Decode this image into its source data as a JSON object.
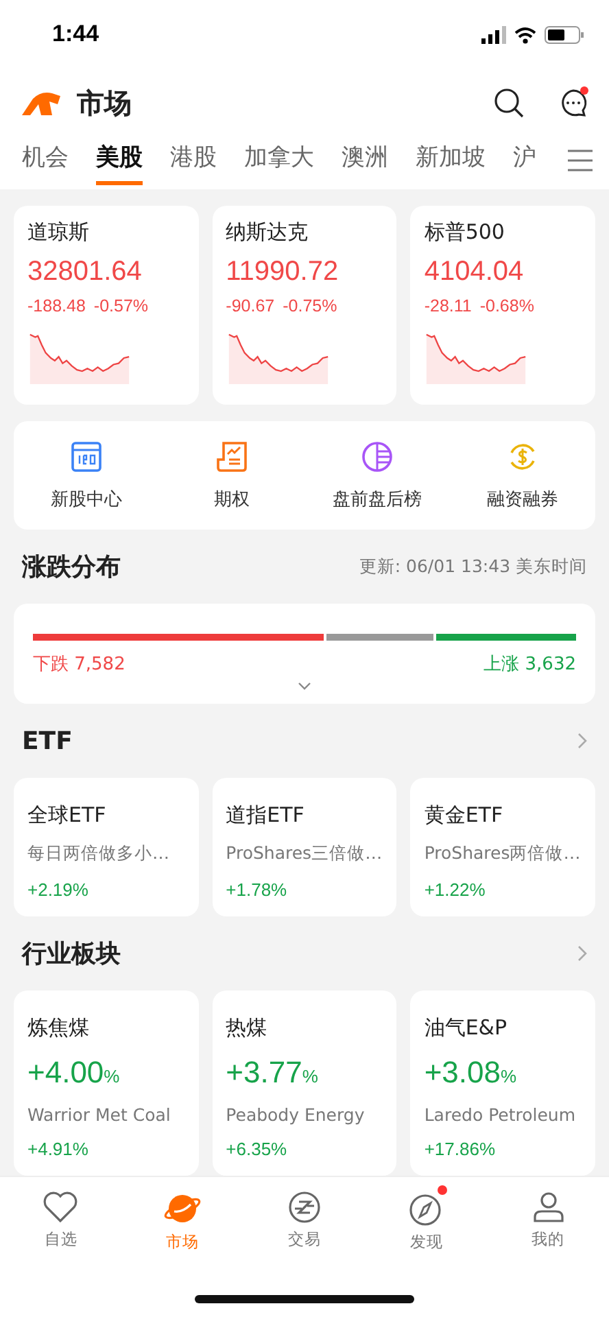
{
  "status_bar": {
    "time": "1:44"
  },
  "header": {
    "title": "市场",
    "message_badge": true
  },
  "tabs": [
    {
      "label": "机会",
      "selected": false
    },
    {
      "label": "美股",
      "selected": true
    },
    {
      "label": "港股",
      "selected": false
    },
    {
      "label": "加拿大",
      "selected": false
    },
    {
      "label": "澳洲",
      "selected": false
    },
    {
      "label": "新加坡",
      "selected": false
    },
    {
      "label": "沪",
      "selected": false
    }
  ],
  "indices": [
    {
      "name": "道琼斯",
      "price": "32801.64",
      "change": "-188.48",
      "percent": "-0.57%"
    },
    {
      "name": "纳斯达克",
      "price": "11990.72",
      "change": "-90.67",
      "percent": "-0.75%"
    },
    {
      "name": "标普500",
      "price": "4104.04",
      "change": "-28.11",
      "percent": "-0.68%"
    }
  ],
  "shortcuts": [
    {
      "kind": "ipo",
      "label": "新股中心"
    },
    {
      "kind": "options",
      "label": "期权"
    },
    {
      "kind": "prepost",
      "label": "盘前盘后榜"
    },
    {
      "kind": "margin",
      "label": "融资融券"
    }
  ],
  "breadth": {
    "title": "涨跌分布",
    "updated": "更新: 06/01 13:43 美东时间",
    "down_label": "下跌 7,582",
    "up_label": "上涨 3,632"
  },
  "etf": {
    "title": "ETF",
    "cards": [
      {
        "name": "全球ETF",
        "desc": "每日两倍做多小…",
        "percent": "+2.19%"
      },
      {
        "name": "道指ETF",
        "desc": "ProShares三倍做…",
        "percent": "+1.78%"
      },
      {
        "name": "黄金ETF",
        "desc": "ProShares两倍做…",
        "percent": "+1.22%"
      }
    ]
  },
  "sectors": {
    "title": "行业板块",
    "cards": [
      {
        "name": "炼焦煤",
        "value": "+4.00",
        "unit": "%",
        "leader": "Warrior Met Coal",
        "leader_percent": "+4.91%"
      },
      {
        "name": "热煤",
        "value": "+3.77",
        "unit": "%",
        "leader": "Peabody Energy",
        "leader_percent": "+6.35%"
      },
      {
        "name": "油气E&P",
        "value": "+3.08",
        "unit": "%",
        "leader": "Laredo Petroleum",
        "leader_percent": "+17.86%"
      }
    ]
  },
  "bottom_nav": [
    {
      "kind": "watchlist",
      "label": "自选",
      "selected": false,
      "badge": false
    },
    {
      "kind": "market",
      "label": "市场",
      "selected": true,
      "badge": false
    },
    {
      "kind": "trade",
      "label": "交易",
      "selected": false,
      "badge": false
    },
    {
      "kind": "discover",
      "label": "发现",
      "selected": false,
      "badge": true
    },
    {
      "kind": "me",
      "label": "我的",
      "selected": false,
      "badge": false
    }
  ]
}
